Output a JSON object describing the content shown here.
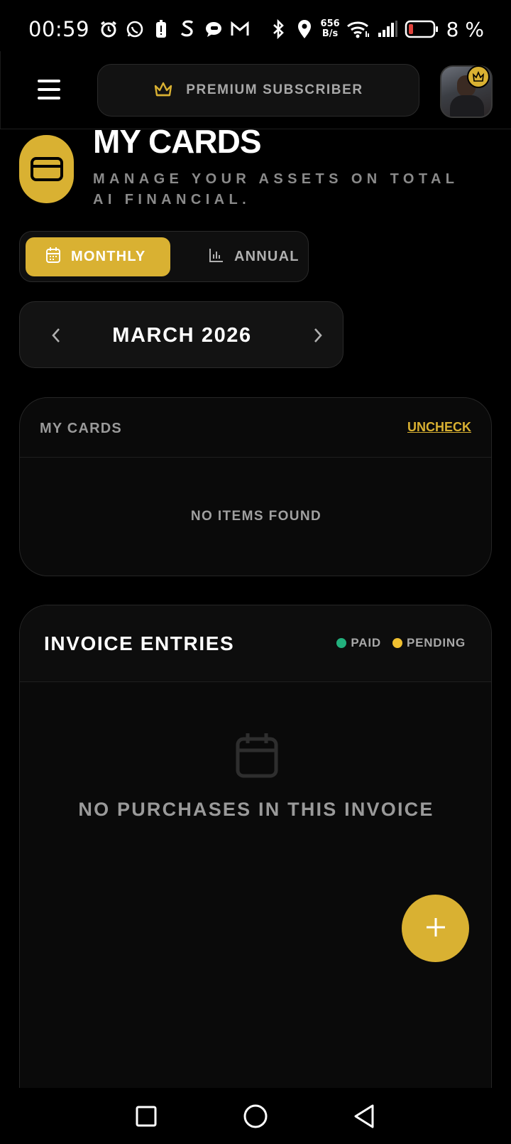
{
  "status_bar": {
    "time": "00:59",
    "net_speed_value": "656",
    "net_speed_unit": "B/s",
    "battery_percent": "8 %",
    "left_icons": [
      "alarm-icon",
      "whatsapp-icon",
      "battery-saver-icon",
      "s-app-icon",
      "chat-icon",
      "gmail-icon"
    ],
    "right_icons": [
      "bluetooth-icon",
      "location-icon",
      "wifi-icon",
      "signal-icon",
      "battery-icon"
    ]
  },
  "header": {
    "menu_icon": "hamburger-menu-icon",
    "premium_label": "PREMIUM SUBSCRIBER",
    "premium_icon": "crown-icon",
    "avatar_badge_icon": "crown-icon"
  },
  "page": {
    "title": "MY CARDS",
    "subtitle": "MANAGE YOUR ASSETS ON TOTAL AI FINANCIAL.",
    "title_icon": "credit-card-icon"
  },
  "view_toggle": {
    "options": [
      {
        "label": "MONTHLY",
        "icon": "calendar-icon",
        "active": true
      },
      {
        "label": "ANNUAL",
        "icon": "bar-chart-icon",
        "active": false
      }
    ]
  },
  "month_picker": {
    "label": "MARCH 2026",
    "prev_icon": "chevron-left-icon",
    "next_icon": "chevron-right-icon"
  },
  "cards_panel": {
    "title": "MY CARDS",
    "action_label": "UNCHECK",
    "empty_text": "NO ITEMS FOUND"
  },
  "invoice_panel": {
    "title": "INVOICE ENTRIES",
    "legend": [
      {
        "label": "PAID",
        "color": "#22b07d"
      },
      {
        "label": "PENDING",
        "color": "#f0c030"
      }
    ],
    "empty_icon": "calendar-icon",
    "empty_text": "NO PURCHASES IN THIS INVOICE"
  },
  "fab": {
    "icon": "plus-icon"
  },
  "nav_bar": {
    "icons": [
      "recent-apps-icon",
      "home-icon",
      "back-icon"
    ]
  },
  "colors": {
    "accent": "#d9b132",
    "background": "#000000",
    "panel": "#0a0a0a"
  }
}
